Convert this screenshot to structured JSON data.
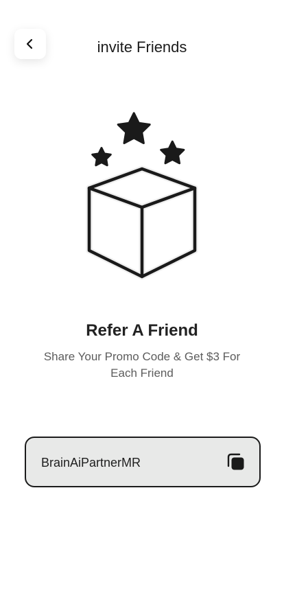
{
  "header": {
    "title": "invite Friends",
    "back_icon": "chevron-left-icon"
  },
  "hero": {
    "icon": "gift-box-with-stars-icon",
    "heading": "Refer A Friend",
    "subtitle": "Share Your Promo Code & Get $3 For Each Friend"
  },
  "promo": {
    "code": "BrainAiPartnerMR",
    "copy_icon": "copy-icon"
  },
  "colors": {
    "text": "#1b1b1b",
    "muted": "#5c5c5c",
    "field_bg": "#e8e9e8"
  }
}
